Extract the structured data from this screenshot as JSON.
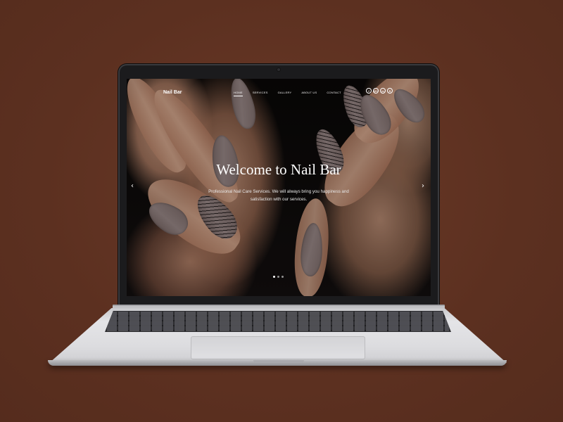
{
  "site": {
    "brand": "Nail Bar",
    "nav": {
      "items": [
        {
          "label": "HOME",
          "active": true
        },
        {
          "label": "SERVICES",
          "active": false
        },
        {
          "label": "GALLERY",
          "active": false
        },
        {
          "label": "ABOUT US",
          "active": false
        },
        {
          "label": "CONTACT",
          "active": false
        }
      ]
    },
    "socials": [
      {
        "icon": "facebook-icon",
        "glyph": "f"
      },
      {
        "icon": "google-plus-icon",
        "glyph": "G+"
      },
      {
        "icon": "linkedin-icon",
        "glyph": "in"
      },
      {
        "icon": "skype-icon",
        "glyph": "S"
      }
    ],
    "hero": {
      "title": "Welcome to Nail Bar",
      "subtitle": "Professional Nail Care Services. We will always bring you happiness and satisfaction with our services.",
      "prev_glyph": "‹",
      "next_glyph": "›",
      "slides_count": 3,
      "active_slide": 1
    }
  },
  "colors": {
    "background": "#5e3121",
    "text": "#ffffff",
    "nail": "#a39190"
  }
}
